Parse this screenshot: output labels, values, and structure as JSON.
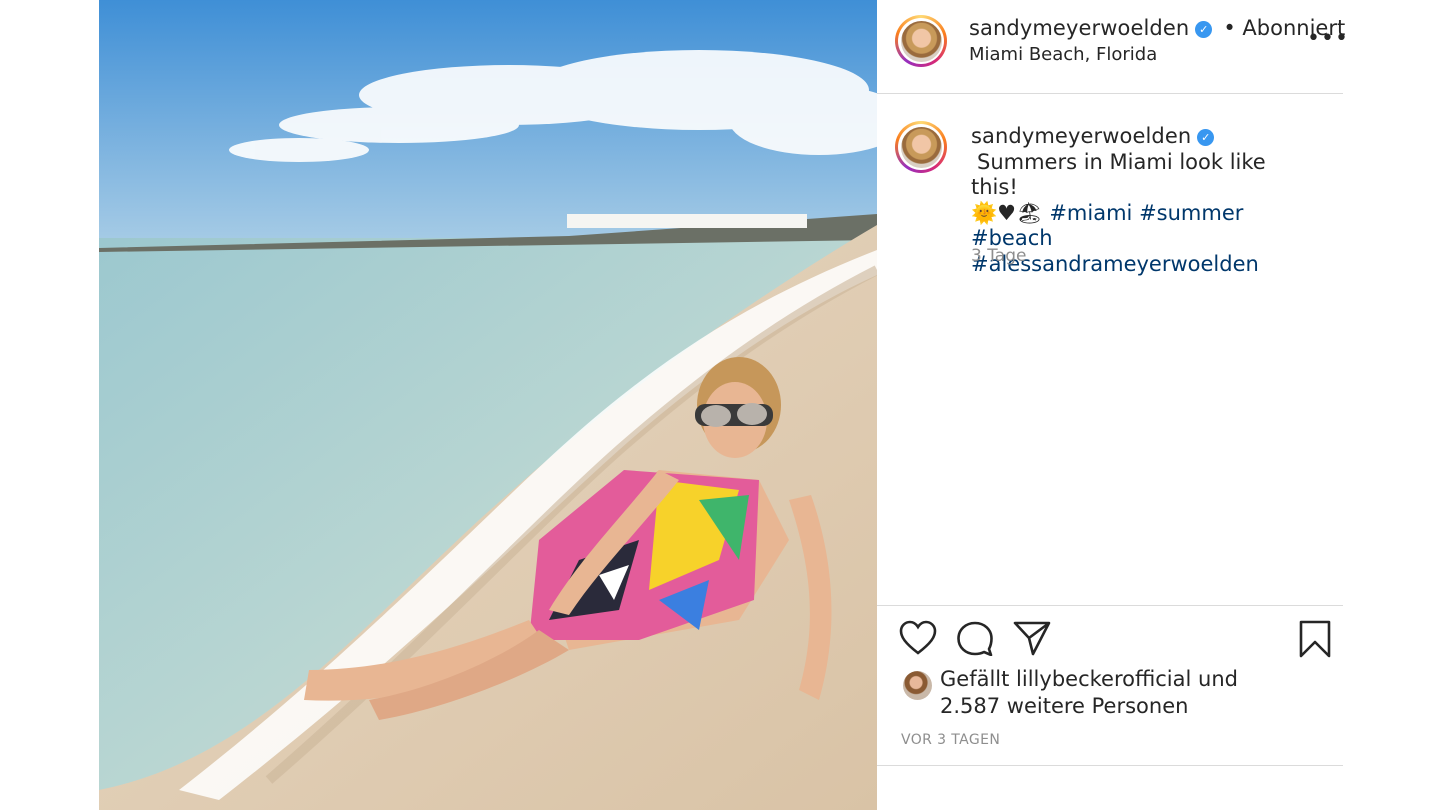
{
  "post": {
    "username": "sandymeyerwoelden",
    "follow_status": "• Abonniert",
    "location": "Miami Beach, Florida",
    "more_icon": "ellipsis-icon",
    "caption_lead": "Summers in Miami look like this!",
    "caption_emoji": "🌞♥🏖",
    "hashtags": [
      "#miami",
      "#summer",
      "#beach",
      "#alessandrameyerwoelden"
    ],
    "caption_age": "3 Tage",
    "likes_prefix": "Gefällt",
    "likes_user": "lillybeckerofficial",
    "likes_and": "und",
    "likes_count": "2.587 weitere Personen",
    "timestamp": "VOR 3 TAGEN"
  },
  "icons": {
    "like": "heart-icon",
    "comment": "comment-icon",
    "share": "paper-plane-icon",
    "save": "bookmark-icon",
    "verified": "verified-badge-icon"
  },
  "colors": {
    "verified": "#3897f0",
    "hashtag": "#00376b",
    "muted": "#8e8e8e",
    "divider": "#dbdbdb"
  }
}
